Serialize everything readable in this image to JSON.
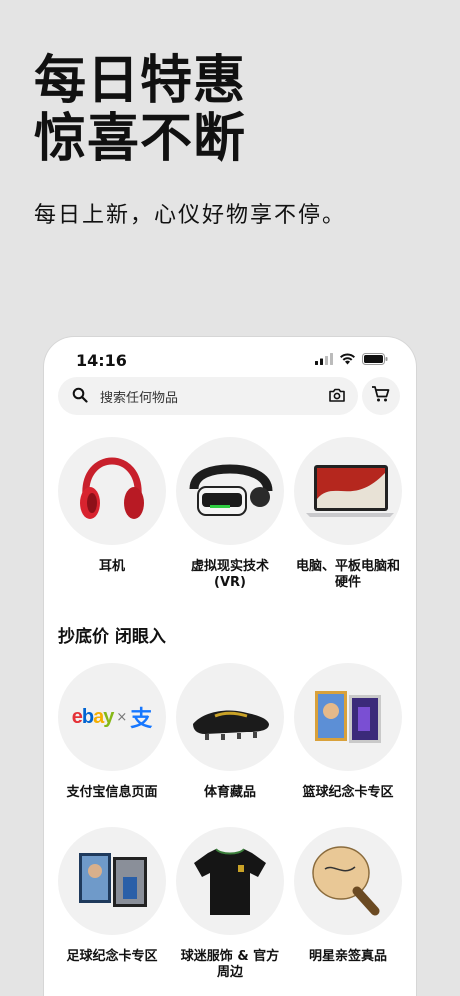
{
  "promo": {
    "headline_line1": "每日特惠",
    "headline_line2": "惊喜不断",
    "subline": "每日上新，心仪好物享不停。"
  },
  "status_bar": {
    "time": "14:16",
    "icons": [
      "signal-icon",
      "wifi-icon",
      "battery-icon"
    ]
  },
  "search": {
    "placeholder": "搜索任何物品",
    "icons": [
      "search-icon",
      "camera-icon",
      "cart-icon"
    ]
  },
  "categories": [
    {
      "label": "耳机",
      "icon": "headphones-image"
    },
    {
      "label": "虚拟现实技术 (VR)",
      "icon": "vr-headset-image"
    },
    {
      "label": "电脑、平板电脑和硬件",
      "icon": "laptop-image"
    }
  ],
  "section": {
    "title": "抄底价 闭眼入"
  },
  "deals": [
    {
      "label": "支付宝信息页面",
      "icon": "ebay-alipay-logo"
    },
    {
      "label": "体育藏品",
      "icon": "football-boot-image"
    },
    {
      "label": "篮球纪念卡专区",
      "icon": "basketball-cards-image"
    },
    {
      "label": "足球纪念卡专区",
      "icon": "soccer-cards-image"
    },
    {
      "label": "球迷服饰 & 官方周边",
      "icon": "jersey-image"
    },
    {
      "label": "明星亲签真品",
      "icon": "pingpong-paddle-image"
    }
  ],
  "logo_text": {
    "ebay": "ebay",
    "x": "×",
    "alipay": "支"
  },
  "colors": {
    "background": "#e4e4e4",
    "ebay_e": "#e53238",
    "ebay_b": "#0064d2",
    "ebay_a": "#f5af02",
    "ebay_y": "#86b817",
    "alipay_blue": "#1677ff"
  }
}
